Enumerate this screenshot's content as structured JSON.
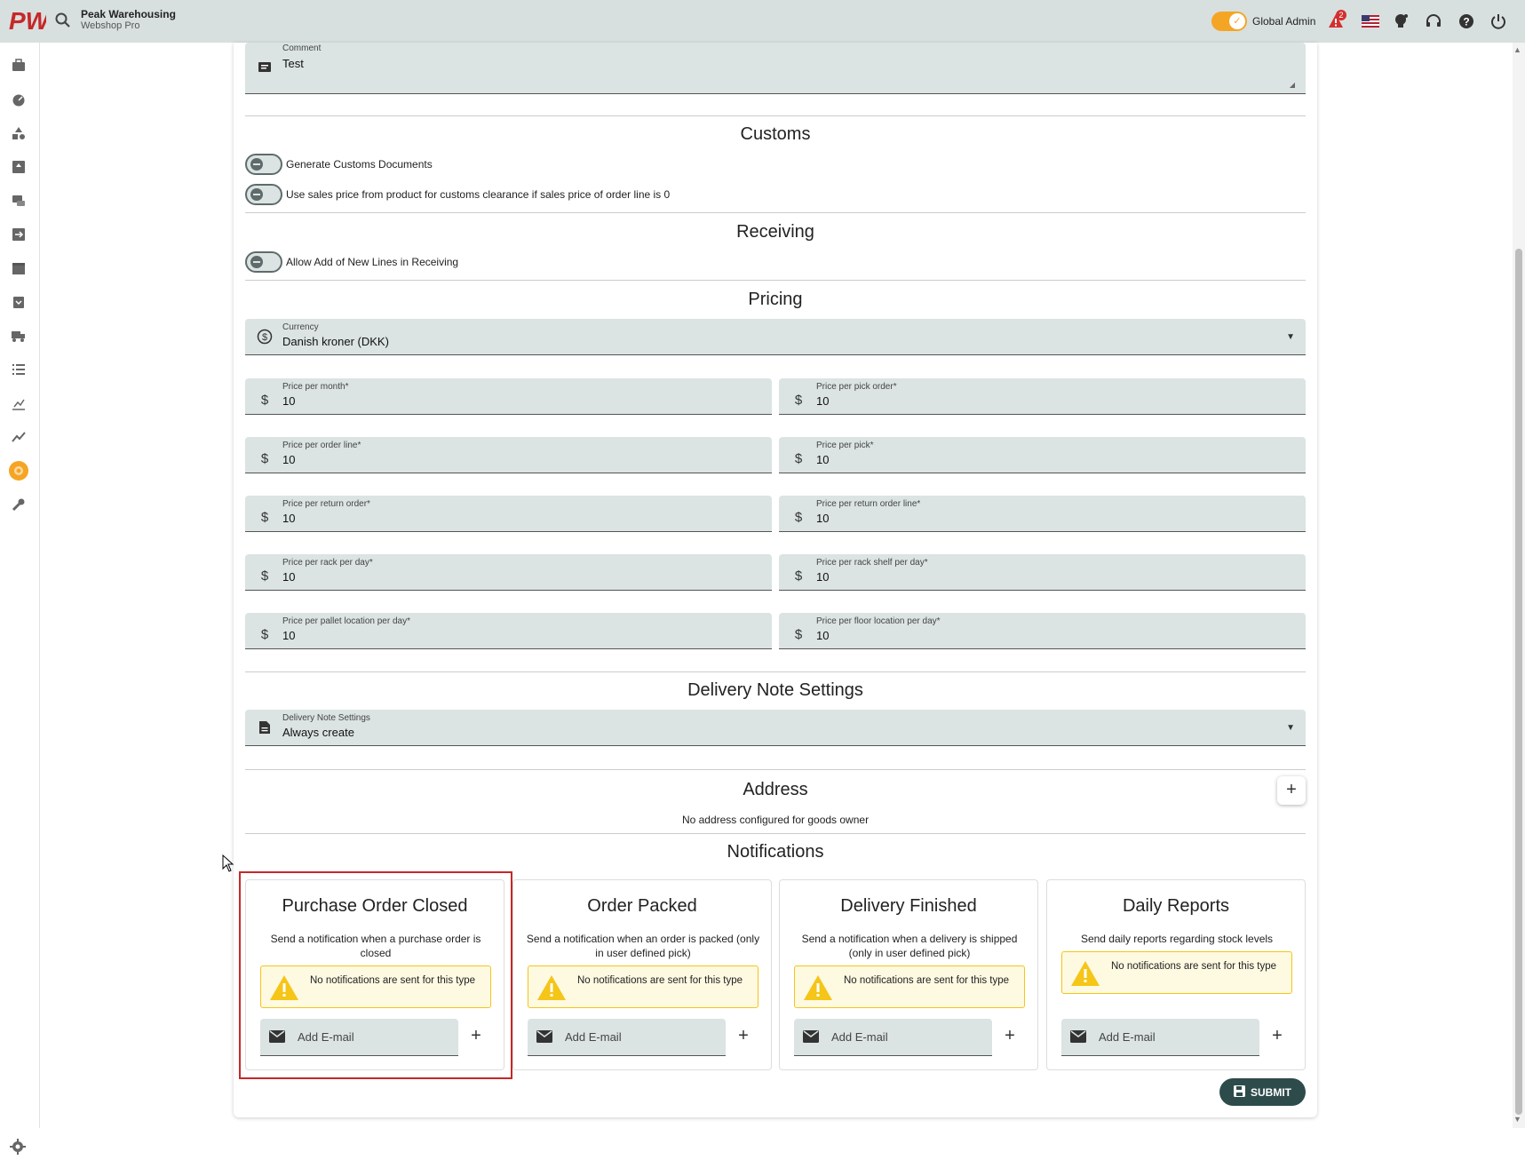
{
  "app": {
    "name": "Peak Warehousing",
    "subtitle": "Webshop Pro",
    "logo_text": "PW"
  },
  "header": {
    "role_label": "Global Admin",
    "role_toggle_on": true,
    "notification_count": "2",
    "icons": [
      "search-icon",
      "alert-icon",
      "us-flag-icon",
      "lightbulb-icon",
      "headset-icon",
      "help-icon",
      "power-icon"
    ]
  },
  "sidebar": {
    "items": [
      "briefcase-icon",
      "dashboard-icon",
      "shapes-icon",
      "inbox-upload-icon",
      "returns-icon",
      "transfer-icon",
      "warehouse-icon",
      "receiving-icon",
      "truck-icon",
      "list-icon",
      "chart-icon",
      "trend-icon",
      "goods-owner-icon",
      "wrench-icon"
    ],
    "active_item": "goods-owner-icon",
    "bottom": "settings-icon"
  },
  "comment": {
    "label": "Comment",
    "value": "Test"
  },
  "customs": {
    "title": "Customs",
    "toggles": [
      {
        "label": "Generate Customs Documents",
        "on": false
      },
      {
        "label": "Use sales price from product for customs clearance if sales price of order line is 0",
        "on": false
      }
    ]
  },
  "receiving": {
    "title": "Receiving",
    "toggles": [
      {
        "label": "Allow Add of New Lines in Receiving",
        "on": false
      }
    ]
  },
  "pricing": {
    "title": "Pricing",
    "currency": {
      "label": "Currency",
      "value": "Danish kroner (DKK)"
    },
    "fields": [
      {
        "label": "Price per month*",
        "value": "10",
        "icon": "$"
      },
      {
        "label": "Price per pick order*",
        "value": "10",
        "icon": "$"
      },
      {
        "label": "Price per order line*",
        "value": "10",
        "icon": "$"
      },
      {
        "label": "Price per pick*",
        "value": "10",
        "icon": "$"
      },
      {
        "label": "Price per return order*",
        "value": "10",
        "icon": "$"
      },
      {
        "label": "Price per return order line*",
        "value": "10",
        "icon": "$"
      },
      {
        "label": "Price per rack per day*",
        "value": "10",
        "icon": "$"
      },
      {
        "label": "Price per rack shelf per day*",
        "value": "10",
        "icon": "$"
      },
      {
        "label": "Price per pallet location per day*",
        "value": "10",
        "icon": "$"
      },
      {
        "label": "Price per floor location per day*",
        "value": "10",
        "icon": "$"
      }
    ]
  },
  "delivery_note": {
    "title": "Delivery Note Settings",
    "field": {
      "label": "Delivery Note Settings",
      "value": "Always create"
    }
  },
  "address": {
    "title": "Address",
    "add_label": "+",
    "empty_text": "No address configured for goods owner"
  },
  "notifications": {
    "title": "Notifications",
    "cards": [
      {
        "title": "Purchase Order Closed",
        "desc": "Send a notification when a purchase order is closed",
        "warning": "No notifications are sent for this type",
        "email_placeholder": "Add E-mail",
        "add": "+"
      },
      {
        "title": "Order Packed",
        "desc": "Send a notification when an order is packed (only in user defined pick)",
        "warning": "No notifications are sent for this type",
        "email_placeholder": "Add E-mail",
        "add": "+"
      },
      {
        "title": "Delivery Finished",
        "desc": "Send a notification when a delivery is shipped (only in user defined pick)",
        "warning": "No notifications are sent for this type",
        "email_placeholder": "Add E-mail",
        "add": "+"
      },
      {
        "title": "Daily Reports",
        "desc": "Send daily reports regarding stock levels",
        "warning": "No notifications are sent for this type",
        "email_placeholder": "Add E-mail",
        "add": "+"
      }
    ]
  },
  "submit_label": "SUBMIT",
  "colors": {
    "accent": "#f5a524",
    "field_bg": "#dbe3e3",
    "submit_bg": "#2e4b4b",
    "highlight": "#c62828",
    "warning_bg": "#fef9e1"
  }
}
